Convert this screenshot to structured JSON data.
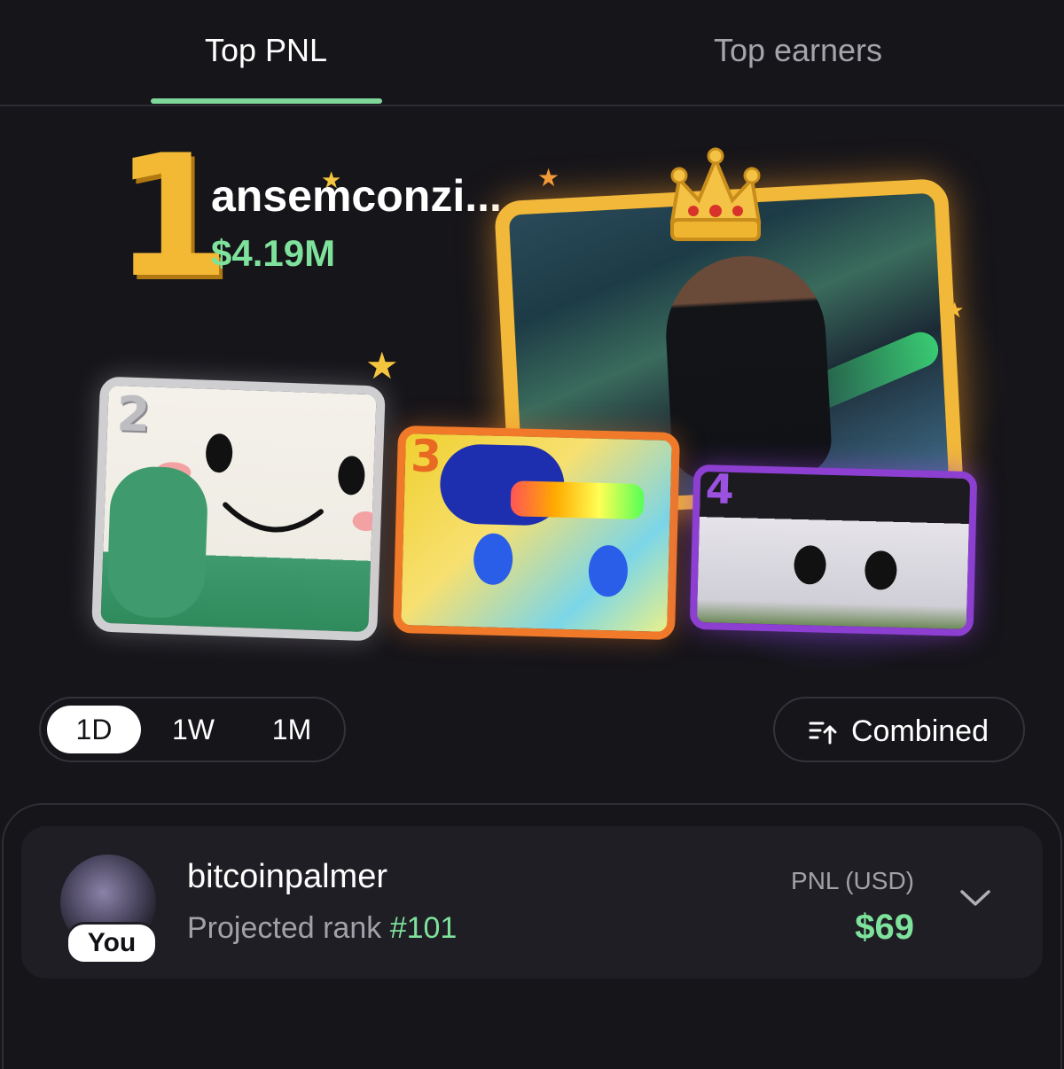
{
  "tabs": [
    {
      "label": "Top PNL",
      "active": true
    },
    {
      "label": "Top earners",
      "active": false
    }
  ],
  "leaderboard": {
    "rank_one_number": "1",
    "leader_name": "ansemconzi...",
    "leader_value": "$4.19M",
    "cards": [
      {
        "rank": "1"
      },
      {
        "rank": "2"
      },
      {
        "rank": "3"
      },
      {
        "rank": "4"
      }
    ]
  },
  "filters": {
    "ranges": [
      "1D",
      "1W",
      "1M"
    ],
    "selected_range": "1D",
    "sort_label": "Combined",
    "sort_icon": "sort-ascending-icon"
  },
  "user": {
    "name": "bitcoinpalmer",
    "badge": "You",
    "projected_label": "Projected rank",
    "projected_rank": "#101",
    "pnl_label": "PNL (USD)",
    "pnl_value": "$69"
  },
  "colors": {
    "accent_green": "#7ee29c",
    "gold": "#f2b83a",
    "silver": "#cfcfd2",
    "orange": "#f07a2a",
    "purple": "#8c3fd0",
    "background": "#16151a"
  }
}
